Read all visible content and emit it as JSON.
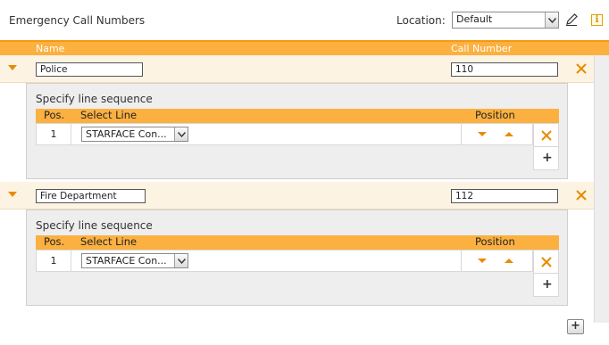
{
  "header": {
    "title": "Emergency Call Numbers",
    "location_label": "Location:",
    "location_value": "Default"
  },
  "columns": {
    "name": "Name",
    "call_number": "Call Number"
  },
  "icons": {
    "expand": "chevron-down-icon",
    "edit": "pencil-icon",
    "info": "info-icon",
    "remove": "close-icon",
    "add": "plus-icon",
    "move_down": "arrow-down-icon",
    "move_up": "arrow-up-icon"
  },
  "colors": {
    "accent": "#fbb040",
    "accent_dark": "#e88b00",
    "row_bg": "#fdf3e3",
    "panel_bg": "#eeeeee"
  },
  "entries": [
    {
      "name": "Police",
      "number": "110",
      "spec_label": "Specify line sequence",
      "table_headers": {
        "pos": "Pos.",
        "line": "Select Line",
        "position": "Position"
      },
      "rows": [
        {
          "pos": "1",
          "line": "STARFACE Con..."
        }
      ]
    },
    {
      "name": "Fire Department",
      "number": "112",
      "spec_label": "Specify line sequence",
      "table_headers": {
        "pos": "Pos.",
        "line": "Select Line",
        "position": "Position"
      },
      "rows": [
        {
          "pos": "1",
          "line": "STARFACE Con..."
        }
      ]
    }
  ],
  "info_glyph": "i",
  "add_glyph": "+"
}
